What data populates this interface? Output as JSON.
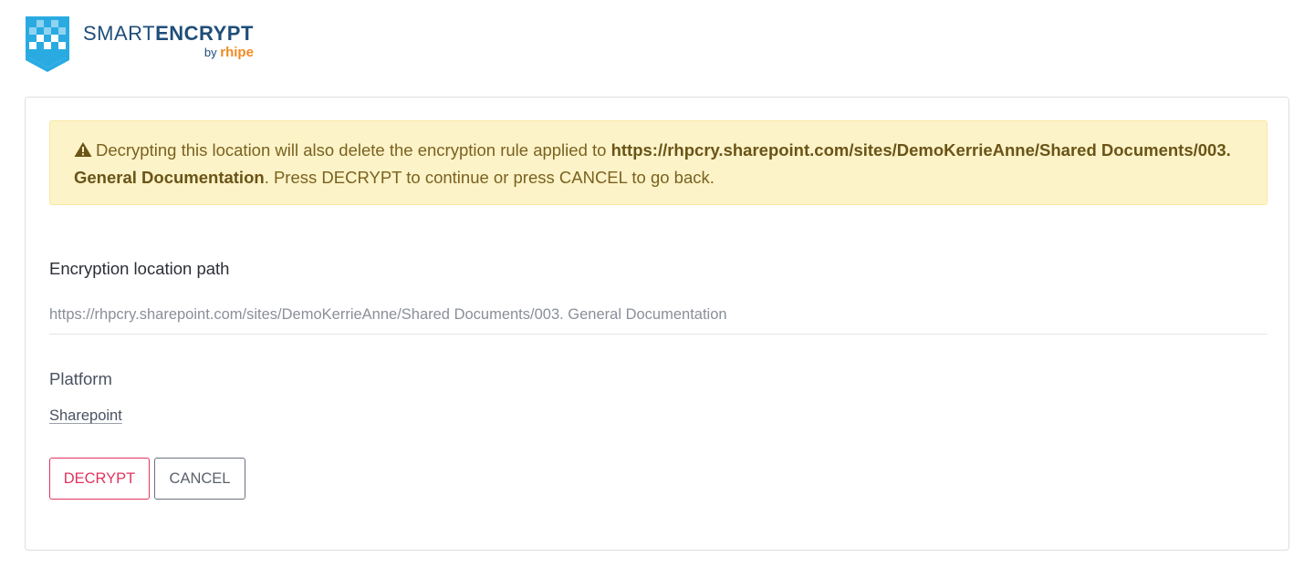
{
  "brand": {
    "name_light": "SMART",
    "name_bold": "ENCRYPT",
    "by": "by",
    "partner": "rhipe",
    "colors": {
      "primary": "#1f4e79",
      "accent": "#29abe2",
      "partner": "#f08a24"
    }
  },
  "alert": {
    "icon": "warning-icon",
    "text_before": "Decrypting this location will also delete the encryption rule applied to ",
    "path": "https://rhpcry.sharepoint.com/sites/DemoKerrieAnne/Shared Documents/003. General Documentation",
    "text_after": ". Press DECRYPT to continue or press CANCEL to go back.",
    "colors": {
      "background": "#fdf3c8",
      "text": "#7a6220"
    }
  },
  "fields": {
    "path_label": "Encryption location path",
    "path_value": "https://rhpcry.sharepoint.com/sites/DemoKerrieAnne/Shared Documents/003. General Documentation",
    "platform_label": "Platform",
    "platform_value": "Sharepoint"
  },
  "actions": {
    "decrypt_label": "DECRYPT",
    "cancel_label": "CANCEL",
    "colors": {
      "decrypt": "#e0345f",
      "cancel": "#6c7280"
    }
  }
}
